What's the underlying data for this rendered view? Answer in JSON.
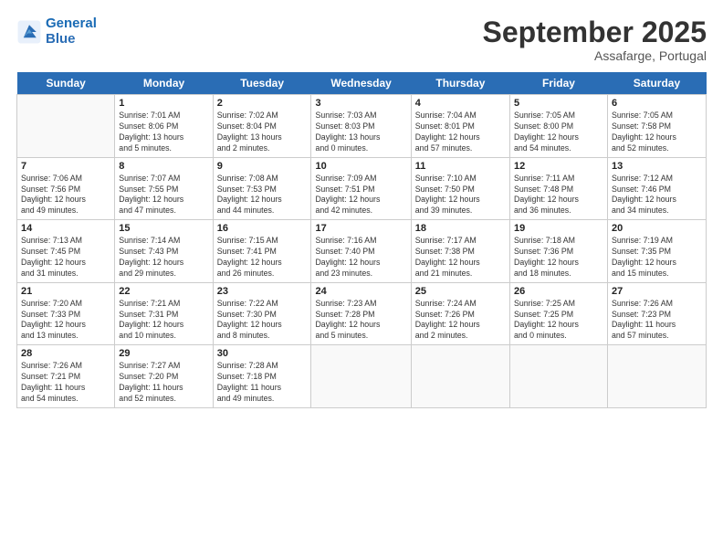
{
  "header": {
    "logo_line1": "General",
    "logo_line2": "Blue",
    "month": "September 2025",
    "location": "Assafarge, Portugal"
  },
  "days_of_week": [
    "Sunday",
    "Monday",
    "Tuesday",
    "Wednesday",
    "Thursday",
    "Friday",
    "Saturday"
  ],
  "weeks": [
    [
      {
        "date": "",
        "info": ""
      },
      {
        "date": "1",
        "info": "Sunrise: 7:01 AM\nSunset: 8:06 PM\nDaylight: 13 hours\nand 5 minutes."
      },
      {
        "date": "2",
        "info": "Sunrise: 7:02 AM\nSunset: 8:04 PM\nDaylight: 13 hours\nand 2 minutes."
      },
      {
        "date": "3",
        "info": "Sunrise: 7:03 AM\nSunset: 8:03 PM\nDaylight: 13 hours\nand 0 minutes."
      },
      {
        "date": "4",
        "info": "Sunrise: 7:04 AM\nSunset: 8:01 PM\nDaylight: 12 hours\nand 57 minutes."
      },
      {
        "date": "5",
        "info": "Sunrise: 7:05 AM\nSunset: 8:00 PM\nDaylight: 12 hours\nand 54 minutes."
      },
      {
        "date": "6",
        "info": "Sunrise: 7:05 AM\nSunset: 7:58 PM\nDaylight: 12 hours\nand 52 minutes."
      }
    ],
    [
      {
        "date": "7",
        "info": "Sunrise: 7:06 AM\nSunset: 7:56 PM\nDaylight: 12 hours\nand 49 minutes."
      },
      {
        "date": "8",
        "info": "Sunrise: 7:07 AM\nSunset: 7:55 PM\nDaylight: 12 hours\nand 47 minutes."
      },
      {
        "date": "9",
        "info": "Sunrise: 7:08 AM\nSunset: 7:53 PM\nDaylight: 12 hours\nand 44 minutes."
      },
      {
        "date": "10",
        "info": "Sunrise: 7:09 AM\nSunset: 7:51 PM\nDaylight: 12 hours\nand 42 minutes."
      },
      {
        "date": "11",
        "info": "Sunrise: 7:10 AM\nSunset: 7:50 PM\nDaylight: 12 hours\nand 39 minutes."
      },
      {
        "date": "12",
        "info": "Sunrise: 7:11 AM\nSunset: 7:48 PM\nDaylight: 12 hours\nand 36 minutes."
      },
      {
        "date": "13",
        "info": "Sunrise: 7:12 AM\nSunset: 7:46 PM\nDaylight: 12 hours\nand 34 minutes."
      }
    ],
    [
      {
        "date": "14",
        "info": "Sunrise: 7:13 AM\nSunset: 7:45 PM\nDaylight: 12 hours\nand 31 minutes."
      },
      {
        "date": "15",
        "info": "Sunrise: 7:14 AM\nSunset: 7:43 PM\nDaylight: 12 hours\nand 29 minutes."
      },
      {
        "date": "16",
        "info": "Sunrise: 7:15 AM\nSunset: 7:41 PM\nDaylight: 12 hours\nand 26 minutes."
      },
      {
        "date": "17",
        "info": "Sunrise: 7:16 AM\nSunset: 7:40 PM\nDaylight: 12 hours\nand 23 minutes."
      },
      {
        "date": "18",
        "info": "Sunrise: 7:17 AM\nSunset: 7:38 PM\nDaylight: 12 hours\nand 21 minutes."
      },
      {
        "date": "19",
        "info": "Sunrise: 7:18 AM\nSunset: 7:36 PM\nDaylight: 12 hours\nand 18 minutes."
      },
      {
        "date": "20",
        "info": "Sunrise: 7:19 AM\nSunset: 7:35 PM\nDaylight: 12 hours\nand 15 minutes."
      }
    ],
    [
      {
        "date": "21",
        "info": "Sunrise: 7:20 AM\nSunset: 7:33 PM\nDaylight: 12 hours\nand 13 minutes."
      },
      {
        "date": "22",
        "info": "Sunrise: 7:21 AM\nSunset: 7:31 PM\nDaylight: 12 hours\nand 10 minutes."
      },
      {
        "date": "23",
        "info": "Sunrise: 7:22 AM\nSunset: 7:30 PM\nDaylight: 12 hours\nand 8 minutes."
      },
      {
        "date": "24",
        "info": "Sunrise: 7:23 AM\nSunset: 7:28 PM\nDaylight: 12 hours\nand 5 minutes."
      },
      {
        "date": "25",
        "info": "Sunrise: 7:24 AM\nSunset: 7:26 PM\nDaylight: 12 hours\nand 2 minutes."
      },
      {
        "date": "26",
        "info": "Sunrise: 7:25 AM\nSunset: 7:25 PM\nDaylight: 12 hours\nand 0 minutes."
      },
      {
        "date": "27",
        "info": "Sunrise: 7:26 AM\nSunset: 7:23 PM\nDaylight: 11 hours\nand 57 minutes."
      }
    ],
    [
      {
        "date": "28",
        "info": "Sunrise: 7:26 AM\nSunset: 7:21 PM\nDaylight: 11 hours\nand 54 minutes."
      },
      {
        "date": "29",
        "info": "Sunrise: 7:27 AM\nSunset: 7:20 PM\nDaylight: 11 hours\nand 52 minutes."
      },
      {
        "date": "30",
        "info": "Sunrise: 7:28 AM\nSunset: 7:18 PM\nDaylight: 11 hours\nand 49 minutes."
      },
      {
        "date": "",
        "info": ""
      },
      {
        "date": "",
        "info": ""
      },
      {
        "date": "",
        "info": ""
      },
      {
        "date": "",
        "info": ""
      }
    ]
  ]
}
